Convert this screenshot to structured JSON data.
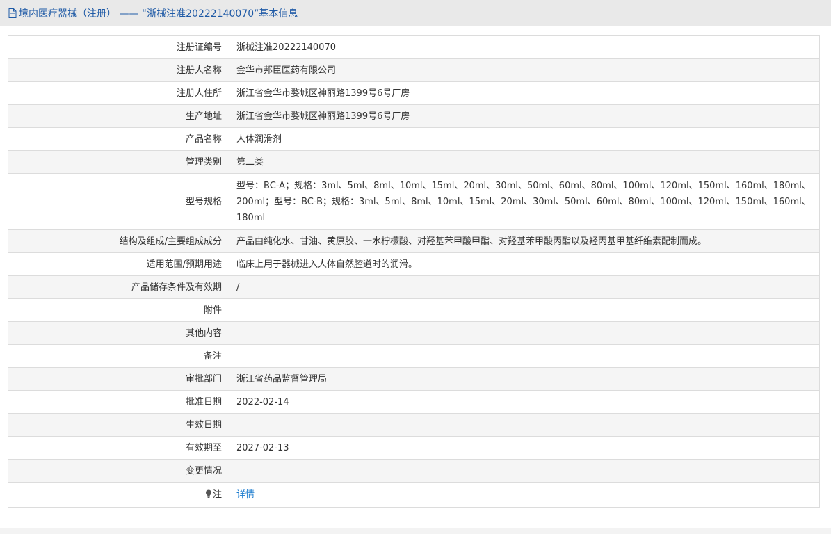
{
  "header": {
    "title": "境内医疗器械（注册） —— “浙械注准20222140070”基本信息",
    "icon": "document-icon"
  },
  "rows": [
    {
      "label": "注册证编号",
      "value": "浙械注准20222140070"
    },
    {
      "label": "注册人名称",
      "value": "金华市邦臣医药有限公司"
    },
    {
      "label": "注册人住所",
      "value": "浙江省金华市婺城区神丽路1399号6号厂房"
    },
    {
      "label": "生产地址",
      "value": "浙江省金华市婺城区神丽路1399号6号厂房"
    },
    {
      "label": "产品名称",
      "value": "人体润滑剂"
    },
    {
      "label": "管理类别",
      "value": "第二类"
    },
    {
      "label": "型号规格",
      "value": "型号：BC-A；规格：3ml、5ml、8ml、10ml、15ml、20ml、30ml、50ml、60ml、80ml、100ml、120ml、150ml、160ml、180ml、200ml；型号：BC-B；规格：3ml、5ml、8ml、10ml、15ml、20ml、30ml、50ml、60ml、80ml、100ml、120ml、150ml、160ml、180ml"
    },
    {
      "label": "结构及组成/主要组成成分",
      "value": "产品由纯化水、甘油、黄原胶、一水柠檬酸、对羟基苯甲酸甲酯、对羟基苯甲酸丙酯以及羟丙基甲基纤维素配制而成。"
    },
    {
      "label": "适用范围/预期用途",
      "value": "临床上用于器械进入人体自然腔道时的润滑。"
    },
    {
      "label": "产品储存条件及有效期",
      "value": "/"
    },
    {
      "label": "附件",
      "value": ""
    },
    {
      "label": "其他内容",
      "value": ""
    },
    {
      "label": "备注",
      "value": ""
    },
    {
      "label": "审批部门",
      "value": "浙江省药品监督管理局"
    },
    {
      "label": "批准日期",
      "value": "2022-02-14"
    },
    {
      "label": "生效日期",
      "value": ""
    },
    {
      "label": "有效期至",
      "value": "2027-02-13"
    },
    {
      "label": "变更情况",
      "value": ""
    }
  ],
  "note": {
    "label": "注",
    "icon": "lightbulb-icon",
    "link": "详情"
  },
  "colors": {
    "header_bg": "#e9e9e9",
    "header_text": "#1f5aa6",
    "link": "#1c7ccf",
    "row_alt": "#f5f5f5",
    "border": "#dcdcdc"
  }
}
